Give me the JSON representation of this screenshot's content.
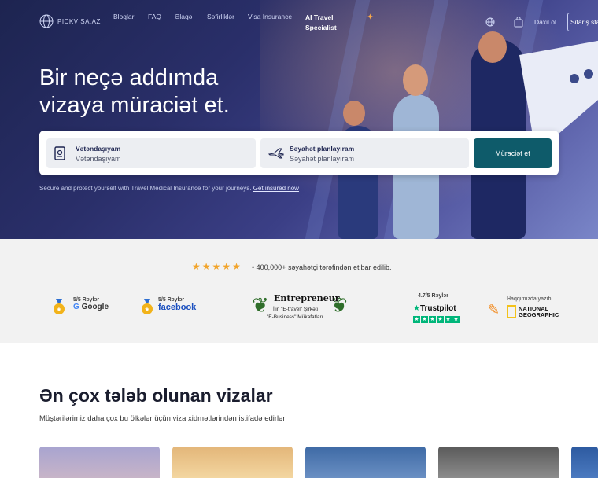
{
  "brand": {
    "logo_text": "PICKVISA.AZ"
  },
  "nav": {
    "links": [
      "Bloqlar",
      "FAQ",
      "Əlaqə",
      "Səfirliklər",
      "Visa Insurance"
    ],
    "ai_line1": "AI Travel",
    "ai_line2": "Specialist",
    "login": "Daxil ol",
    "order": "Sifariş status"
  },
  "hero": {
    "line1": "Bir neçə addımda",
    "line2": "vizaya müraciət et."
  },
  "search": {
    "citizenship_label": "Vətəndaşıyam",
    "citizenship_value": "Vətəndaşıyam",
    "travel_label": "Səyahət planlayıram",
    "travel_value": "Səyahət planlayıram",
    "submit": "Müraciət et"
  },
  "insurance": {
    "text": "Secure and protect yourself with Travel Medical Insurance for your journeys.",
    "link": "Get insured now"
  },
  "trust": {
    "stars_count": 5,
    "summary": "400,000+ səyahətçi tərəfindən etibar edilib.",
    "google_rating": "5/5 Rəylər",
    "google_brand": "Google",
    "facebook_rating": "5/5 Rəylər",
    "facebook_brand": "facebook",
    "entrepreneur_title": "Entrepreneur",
    "entrepreneur_line1": "İlin \"E-travel\" Şirkəti",
    "entrepreneur_line2": "\"E-Business\" Mükafatları",
    "trustpilot_rating": "4.7/5 Rəylər",
    "trustpilot_brand": "Trustpilot",
    "press_label": "Haqqımızda yazıb",
    "press_line1": "NATIONAL",
    "press_line2": "GEOGRAPHIC"
  },
  "popular": {
    "title": "Ən çox tələb olunan vizalar",
    "subtitle": "Müştərilərimiz daha çox bu ölkələr üçün viza xidmətlərindən istifadə edirlər"
  },
  "colors": {
    "accent": "#0e5b6a",
    "star": "#f2a42a",
    "trustpilot": "#00b67a"
  }
}
